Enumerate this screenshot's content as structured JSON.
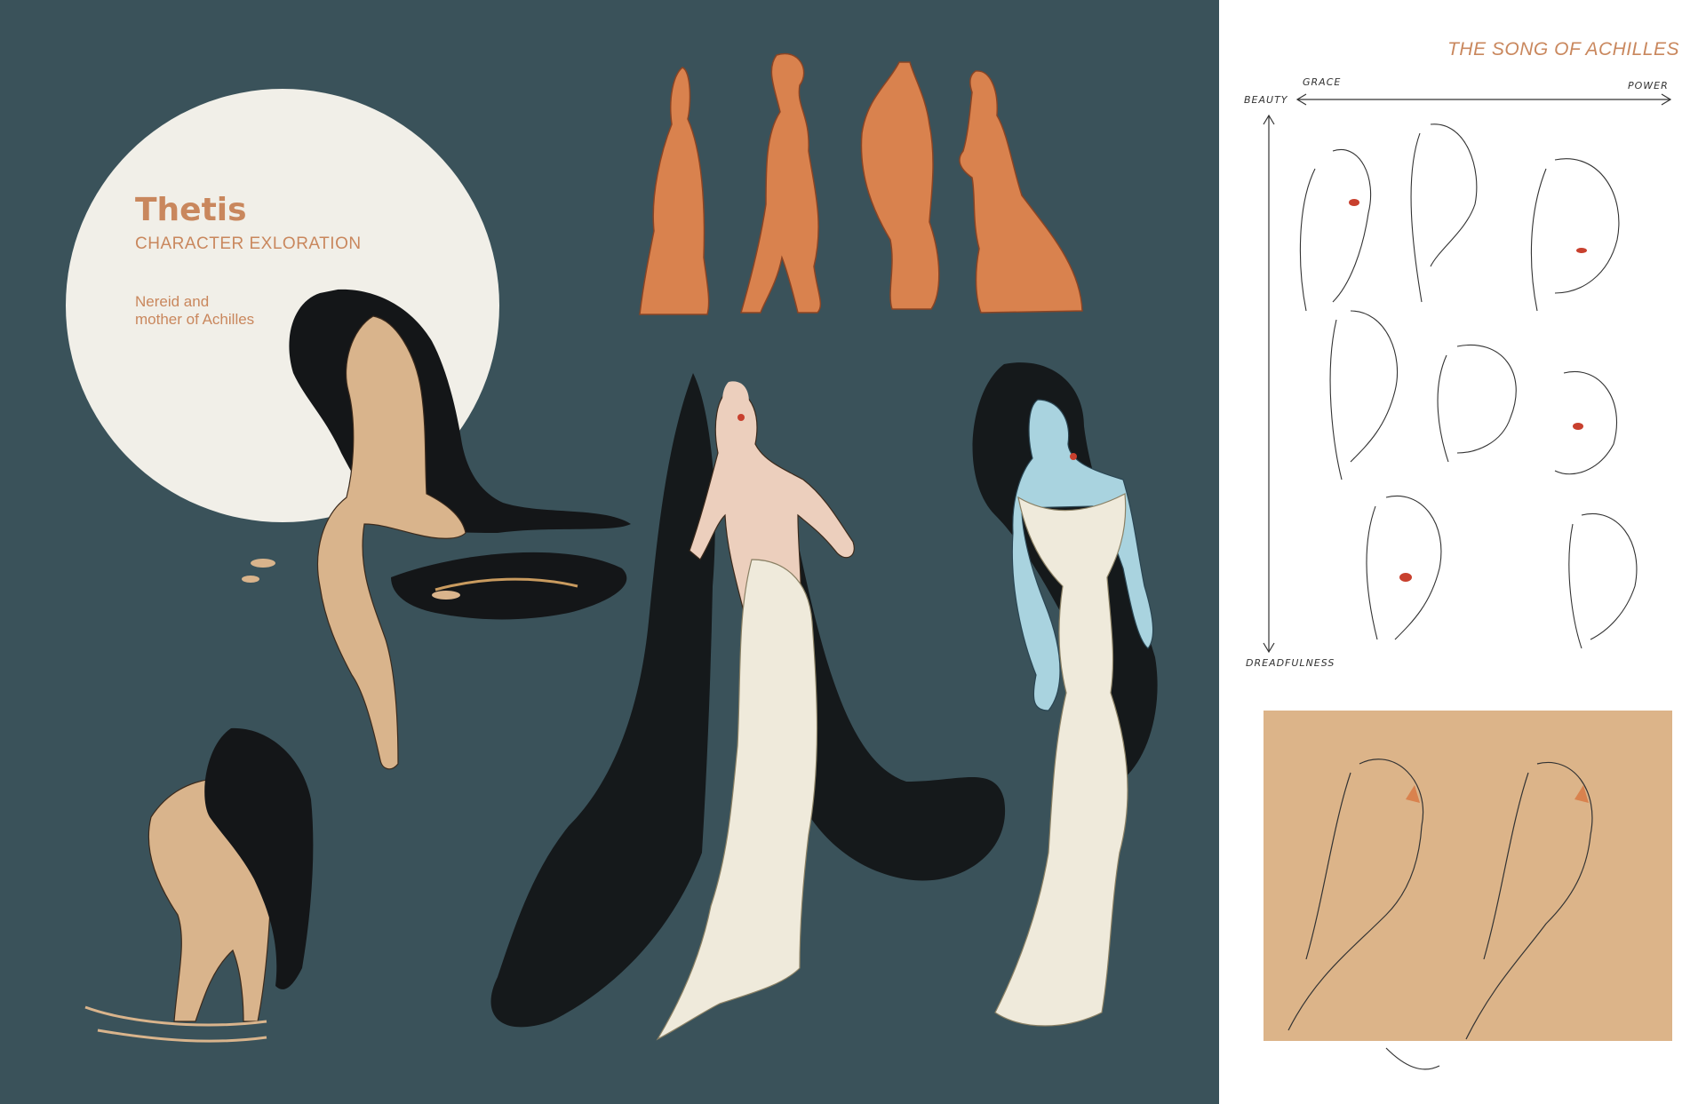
{
  "colors": {
    "background_teal": "#3a525a",
    "moon": "#f1efe8",
    "accent_orange": "#c9875d",
    "sketch_orange": "#d9824e",
    "skin_tan": "#d9b48c",
    "hair_black": "#141618",
    "gown_cream": "#efeadb",
    "pale_blue_skin": "#a9d3df",
    "box_tan": "#dcb489",
    "lip_red": "#c8402e"
  },
  "character": {
    "name": "Thetis",
    "subtitle": "CHARACTER EXLORATION",
    "description": "Nereid and\nmother of Achilles"
  },
  "sheet": {
    "project_title": "THE SONG OF ACHILLES",
    "axis": {
      "beauty": "BEAUTY",
      "grace": "GRACE",
      "power": "POWER",
      "dreadfulness": "DREADFULNESS"
    }
  }
}
